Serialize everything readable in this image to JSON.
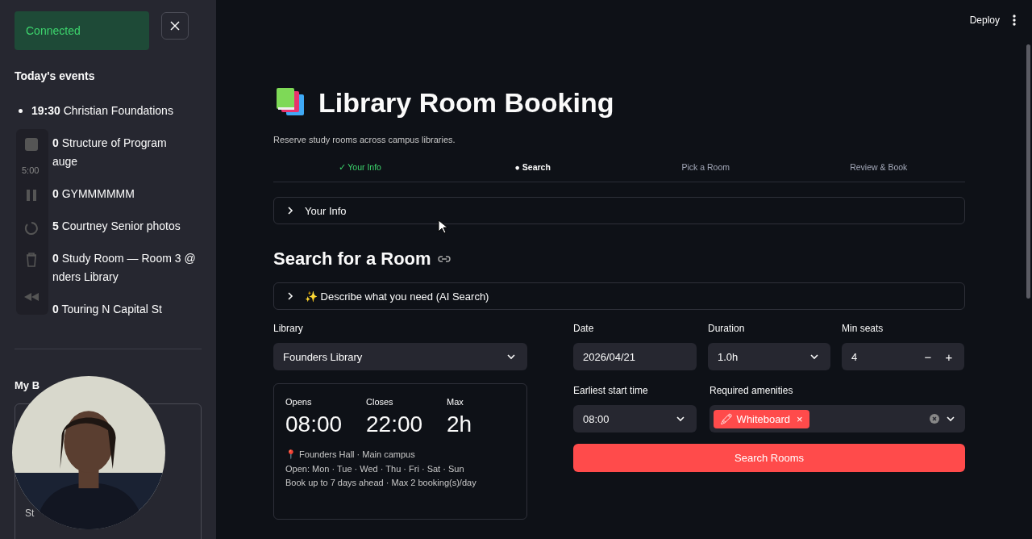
{
  "toast": {
    "text": "Connected"
  },
  "sidebar": {
    "title": "Today's events",
    "events": [
      {
        "bullet": true,
        "lines": [
          "**19:30** Christian Foundations"
        ]
      },
      {
        "bullet": false,
        "lines": [
          "**0** Structure of Program",
          "auge"
        ]
      },
      {
        "bullet": false,
        "lines": [
          "**0** GYMMMMMM"
        ]
      },
      {
        "bullet": false,
        "lines": [
          "**5** Courtney Senior photos"
        ]
      },
      {
        "bullet": false,
        "lines": [
          "**0** Study Room — Room 3 @",
          "nders Library"
        ]
      },
      {
        "bullet": false,
        "lines": [
          "**0** Touring N Capital St"
        ]
      }
    ],
    "section_title": "My B",
    "card_text": "St"
  },
  "recorder": {
    "time": "5:00"
  },
  "header": {
    "deploy": "Deploy"
  },
  "page": {
    "title": "Library Room Booking",
    "subtitle": "Reserve study rooms across campus libraries."
  },
  "steps": [
    {
      "label": "✓ Your Info",
      "done": true,
      "selected": false
    },
    {
      "label": "● Search",
      "done": false,
      "selected": true
    },
    {
      "label": "Pick a Room",
      "done": false,
      "selected": false
    },
    {
      "label": "Review & Book",
      "done": false,
      "selected": false
    }
  ],
  "info_expander": {
    "label": "Your Info",
    "expanded": false
  },
  "search": {
    "heading": "Search for a Room",
    "ai_expander": {
      "label": "✨ Describe what you need (AI Search)",
      "expanded": false
    },
    "library": {
      "label": "Library",
      "value": "Founders Library"
    },
    "stats": [
      {
        "label": "Opens",
        "value": "08:00"
      },
      {
        "label": "Closes",
        "value": "22:00"
      },
      {
        "label": "Max",
        "value": "2h"
      }
    ],
    "details": [
      "📍 Founders Hall · Main campus",
      "Open: Mon · Tue · Wed · Thu · Fri · Sat · Sun",
      "Book up to 7 days ahead · Max 2 booking(s)/day"
    ],
    "date": {
      "label": "Date",
      "value": "2026/04/21"
    },
    "duration": {
      "label": "Duration",
      "value": "1.0h"
    },
    "seats": {
      "label": "Min seats",
      "value": "4",
      "minus": "−",
      "plus": "+"
    },
    "start": {
      "label": "Earliest start time",
      "value": "08:00"
    },
    "amenities": {
      "label": "Required amenities",
      "tags": [
        {
          "label": "🖍 Whiteboard",
          "remove": "×"
        }
      ]
    },
    "button": "Search Rooms"
  }
}
